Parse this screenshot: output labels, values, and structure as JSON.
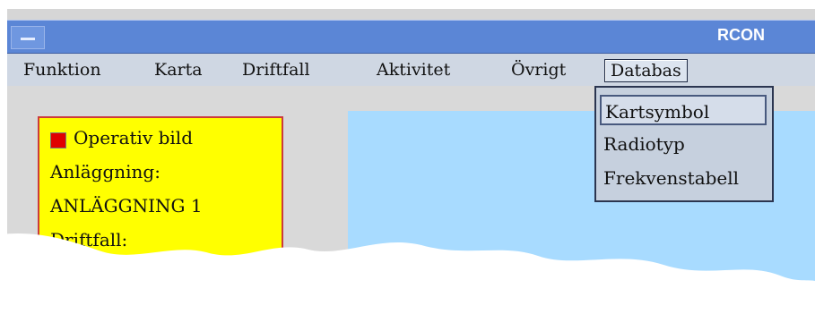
{
  "window": {
    "title": "RCON"
  },
  "menubar": {
    "items": [
      {
        "label": "Funktion"
      },
      {
        "label": "Karta"
      },
      {
        "label": "Driftfall"
      },
      {
        "label": "Aktivitet"
      },
      {
        "label": "Övrigt"
      },
      {
        "label": "Databas"
      }
    ]
  },
  "dropdown": {
    "items": [
      {
        "label": "Kartsymbol"
      },
      {
        "label": "Radiotyp"
      },
      {
        "label": "Frekvenstabell"
      }
    ]
  },
  "info_panel": {
    "checkbox_label": "Operativ bild",
    "lines": [
      "Anläggning:",
      "ANLÄGGNING 1",
      "Driftfall:"
    ]
  },
  "colors": {
    "titlebar": "#5b86d6",
    "map": "#a8dbff",
    "panel": "#ffff00",
    "checkbox": "#e00000"
  },
  "icons": {
    "system_menu": "minus-icon"
  }
}
